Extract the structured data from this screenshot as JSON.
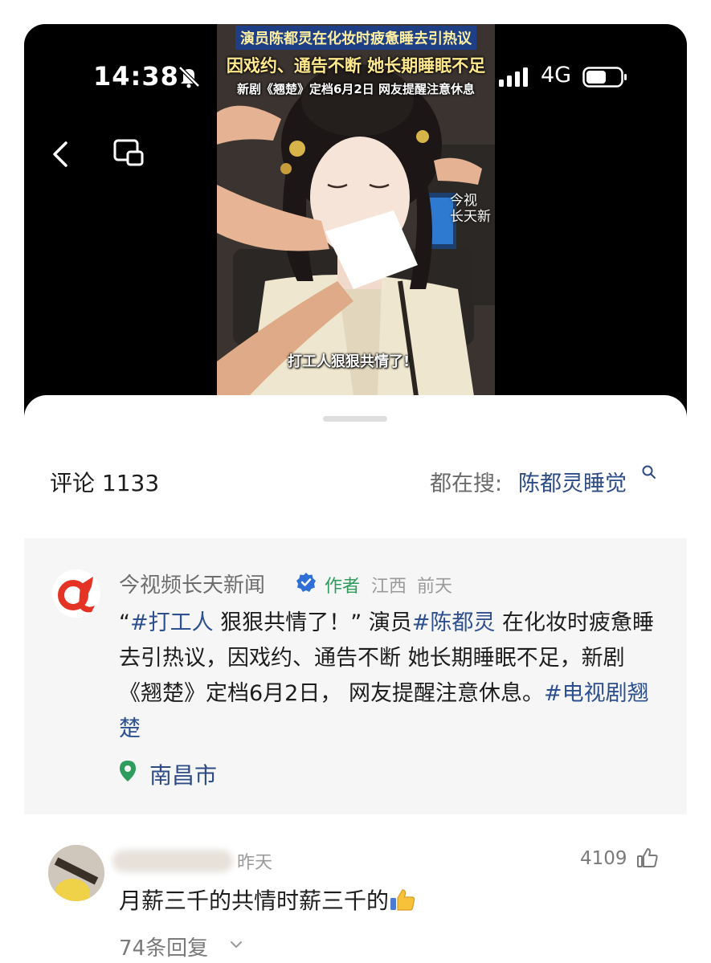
{
  "status_bar": {
    "time": "14:38",
    "network": "4G",
    "icons": [
      "bell-off-icon",
      "signal-icon",
      "battery-icon"
    ]
  },
  "nav": {
    "icons": [
      "back-arrow-icon",
      "picture-in-picture-icon"
    ]
  },
  "video": {
    "headline_1": "演员陈都灵在化妆时疲惫睡去引热议",
    "headline_2": "因戏约、通告不断 她长期睡眠不足",
    "headline_3": "新剧《翘楚》定档6月2日 网友提醒注意休息",
    "watermark_1": "今视",
    "watermark_2": "长天新",
    "caption": "打工人狠狠共情了!"
  },
  "comments": {
    "count_label": "评论 1133",
    "search_prefix": "都在搜:",
    "search_term": "陈都灵睡觉"
  },
  "author_post": {
    "name": "今视频长天新闻",
    "tag": "作者",
    "location_meta": "江西",
    "time": "前天",
    "text_parts": [
      {
        "text": "“",
        "hashtag": false
      },
      {
        "text": "#打工人",
        "hashtag": true
      },
      {
        "text": " 狠狠共情了！” 演员",
        "hashtag": false
      },
      {
        "text": "#陈都灵",
        "hashtag": true
      },
      {
        "text": " 在化妆时疲惫睡去引热议，因戏约、通告不断 她长期睡眠不足，新剧《翘楚》定档6月2日， 网友提醒注意休息。",
        "hashtag": false
      },
      {
        "text": "#电视剧翘楚",
        "hashtag": true
      }
    ],
    "location": "南昌市"
  },
  "reply": {
    "time": "昨天",
    "likes": "4109",
    "text": "月薪三千的共情时薪三千的",
    "emoji": "thumbs-up-emoji",
    "replies": "74条回复"
  },
  "colors": {
    "link_blue": "#2d4b85",
    "author_tag_green": "#2e9c5c",
    "verified_blue": "#2f6fd6",
    "headline_banner": "#1e3f86",
    "headline_text": "#ffe98c"
  }
}
